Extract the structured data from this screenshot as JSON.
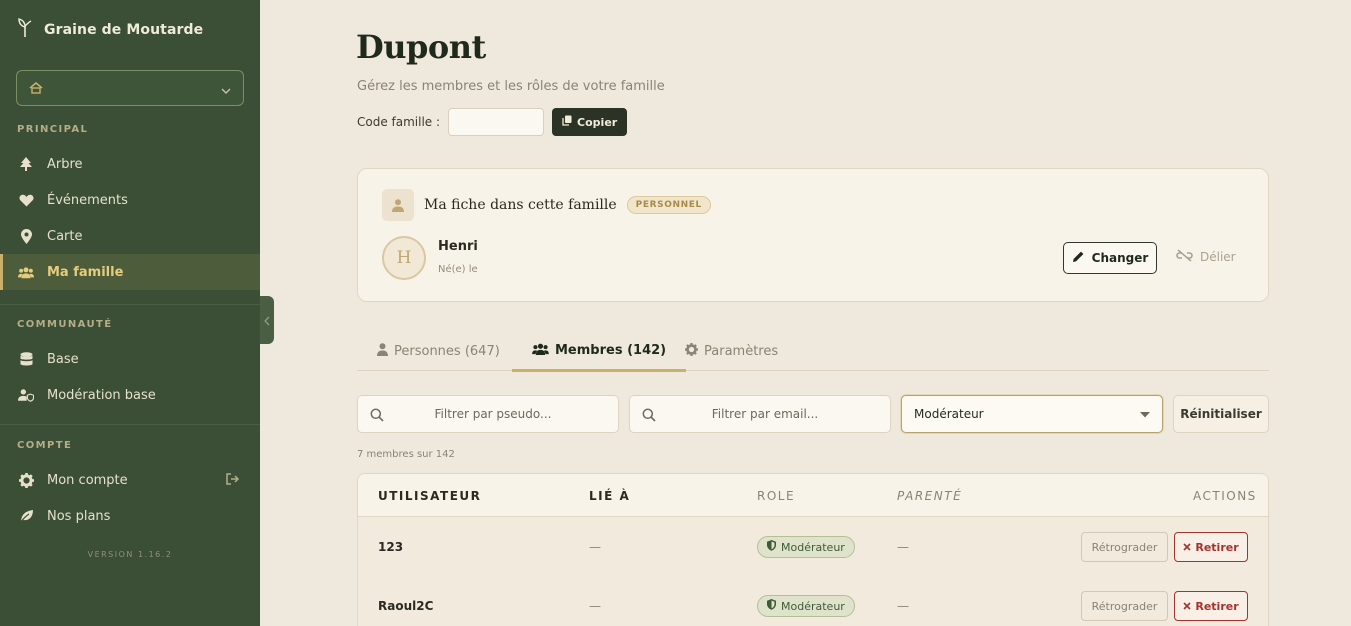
{
  "sidebar": {
    "brand": "Graine de Moutarde",
    "sections": {
      "principal": "PRINCIPAL",
      "communaute": "COMMUNAUTÉ",
      "compte": "COMPTE"
    },
    "items": {
      "arbre": "Arbre",
      "evenements": "Événements",
      "carte": "Carte",
      "ma_famille": "Ma famille",
      "base": "Base",
      "moderation_base": "Modération base",
      "mon_compte": "Mon compte",
      "nos_plans": "Nos plans"
    },
    "version": "VERSION 1.16.2"
  },
  "header": {
    "title": "Dupont",
    "subtitle": "Gérez les membres et les rôles de votre famille",
    "code_label": "Code famille :",
    "code_value": "",
    "copy_label": "Copier"
  },
  "my_card": {
    "title": "Ma fiche dans cette famille",
    "badge": "PERSONNEL",
    "avatar_initial": "H",
    "name": "Henri",
    "born": "Né(e) le",
    "change_label": "Changer",
    "unlink_label": "Délier"
  },
  "tabs": {
    "personnes": "Personnes (647)",
    "membres": "Membres (142)",
    "parametres": "Paramètres"
  },
  "filters": {
    "pseudo_placeholder": "Filtrer par pseudo...",
    "email_placeholder": "Filtrer par email...",
    "role_selected": "Modérateur",
    "reset_label": "Réinitialiser"
  },
  "count_text": "7 membres sur 142",
  "table": {
    "headers": {
      "user": "UTILISATEUR",
      "linked": "LIÉ À",
      "role": "ROLE",
      "parente": "PARENTÉ",
      "actions": "ACTIONS"
    },
    "rows": [
      {
        "user": "123",
        "linked": "—",
        "role": "Modérateur",
        "parente": "—",
        "demote": "Rétrograder",
        "remove": "Retirer"
      },
      {
        "user": "Raoul2C",
        "linked": "—",
        "role": "Modérateur",
        "parente": "—",
        "demote": "Rétrograder",
        "remove": "Retirer"
      }
    ]
  },
  "colors": {
    "sidebar_bg": "#3a4f36",
    "accent_gold": "#c9b06b",
    "danger": "#a4332e",
    "page_bg": "#efe8dc"
  }
}
